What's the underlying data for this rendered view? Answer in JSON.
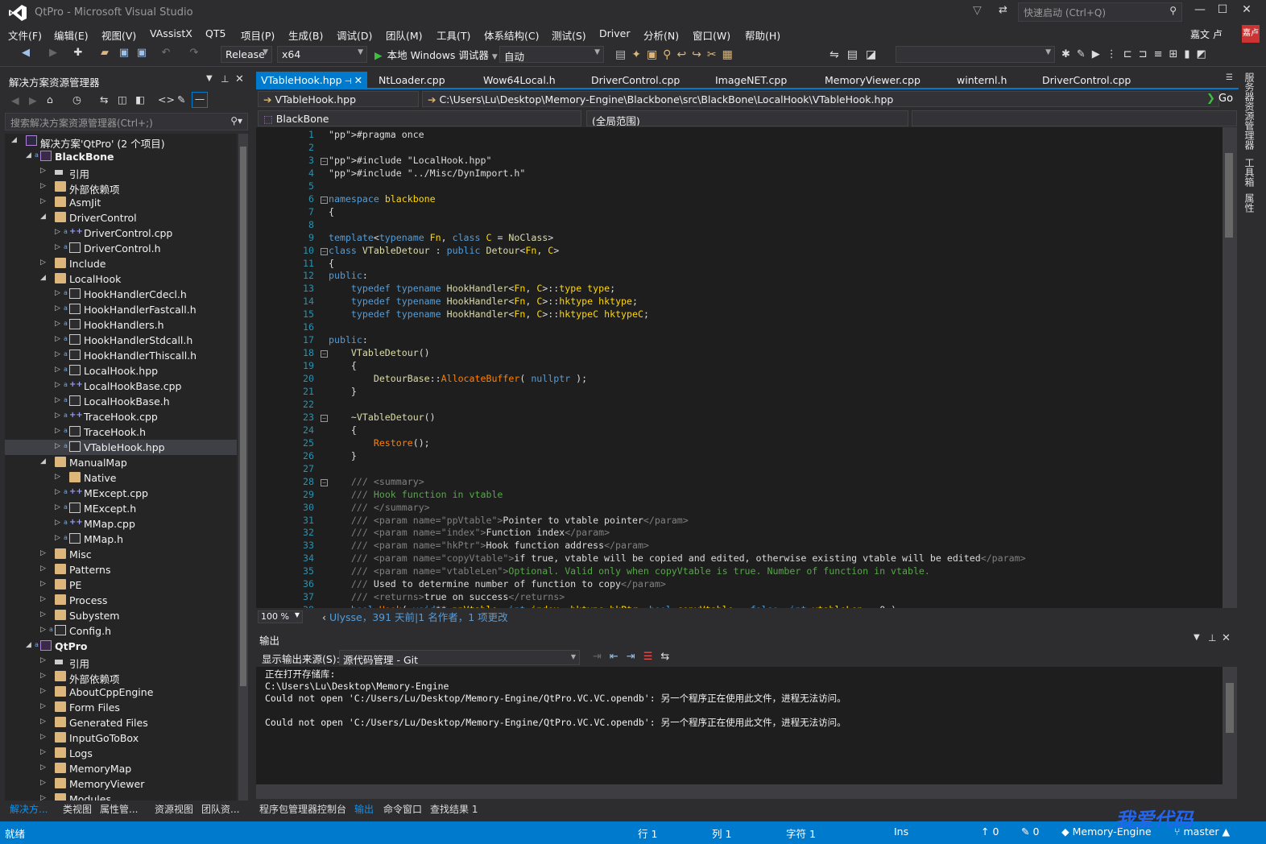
{
  "window": {
    "title": "QtPro - Microsoft Visual Studio",
    "quick_launch": "快速启动 (Ctrl+Q)",
    "user": "嘉文 卢",
    "avatar": "嘉卢"
  },
  "menu": [
    "文件(F)",
    "编辑(E)",
    "视图(V)",
    "VAssistX",
    "QT5",
    "项目(P)",
    "生成(B)",
    "调试(D)",
    "团队(M)",
    "工具(T)",
    "体系结构(C)",
    "测试(S)",
    "Driver",
    "分析(N)",
    "窗口(W)",
    "帮助(H)"
  ],
  "toolbar": {
    "config": "Release",
    "platform": "x64",
    "run_label": "本地 Windows 调试器",
    "run_mode": "自动"
  },
  "solution_explorer": {
    "title": "解决方案资源管理器",
    "search_placeholder": "搜索解决方案资源管理器(Ctrl+;)",
    "items": [
      {
        "label": "解决方案'QtPro' (2 个项目)",
        "type": "solution"
      },
      {
        "label": "BlackBone",
        "type": "project"
      },
      {
        "label": "引用",
        "type": "ref"
      },
      {
        "label": "外部依赖项",
        "type": "folder"
      },
      {
        "label": "AsmJit",
        "type": "folder"
      },
      {
        "label": "DriverControl",
        "type": "folder"
      },
      {
        "label": "DriverControl.cpp",
        "type": "cpp"
      },
      {
        "label": "DriverControl.h",
        "type": "h"
      },
      {
        "label": "Include",
        "type": "folder"
      },
      {
        "label": "LocalHook",
        "type": "folder"
      },
      {
        "label": "HookHandlerCdecl.h",
        "type": "h"
      },
      {
        "label": "HookHandlerFastcall.h",
        "type": "h"
      },
      {
        "label": "HookHandlers.h",
        "type": "h"
      },
      {
        "label": "HookHandlerStdcall.h",
        "type": "h"
      },
      {
        "label": "HookHandlerThiscall.h",
        "type": "h"
      },
      {
        "label": "LocalHook.hpp",
        "type": "h"
      },
      {
        "label": "LocalHookBase.cpp",
        "type": "cpp"
      },
      {
        "label": "LocalHookBase.h",
        "type": "h"
      },
      {
        "label": "TraceHook.cpp",
        "type": "cpp"
      },
      {
        "label": "TraceHook.h",
        "type": "h"
      },
      {
        "label": "VTableHook.hpp",
        "type": "h"
      },
      {
        "label": "ManualMap",
        "type": "folder"
      },
      {
        "label": "Native",
        "type": "folder"
      },
      {
        "label": "MExcept.cpp",
        "type": "cpp"
      },
      {
        "label": "MExcept.h",
        "type": "h"
      },
      {
        "label": "MMap.cpp",
        "type": "cpp"
      },
      {
        "label": "MMap.h",
        "type": "h"
      },
      {
        "label": "Misc",
        "type": "folder"
      },
      {
        "label": "Patterns",
        "type": "folder"
      },
      {
        "label": "PE",
        "type": "folder"
      },
      {
        "label": "Process",
        "type": "folder"
      },
      {
        "label": "Subystem",
        "type": "folder"
      },
      {
        "label": "Config.h",
        "type": "h"
      },
      {
        "label": "QtPro",
        "type": "project"
      },
      {
        "label": "引用",
        "type": "ref"
      },
      {
        "label": "外部依赖项",
        "type": "folder"
      },
      {
        "label": "AboutCppEngine",
        "type": "folder"
      },
      {
        "label": "Form Files",
        "type": "folder"
      },
      {
        "label": "Generated Files",
        "type": "folder"
      },
      {
        "label": "InputGoToBox",
        "type": "folder"
      },
      {
        "label": "Logs",
        "type": "folder"
      },
      {
        "label": "MemoryMap",
        "type": "folder"
      },
      {
        "label": "MemoryViewer",
        "type": "folder"
      },
      {
        "label": "Modules",
        "type": "folder"
      }
    ],
    "bottom_tabs": [
      "解决方...",
      "类视图",
      "属性管...",
      "资源视图",
      "团队资..."
    ]
  },
  "editor": {
    "tabs": [
      "VTableHook.hpp",
      "NtLoader.cpp",
      "Wow64Local.h",
      "DriverControl.cpp",
      "ImageNET.cpp",
      "MemoryViewer.cpp",
      "winternl.h",
      "DriverControl.cpp"
    ],
    "file_combo": "VTableHook.hpp",
    "path": "C:\\Users\\Lu\\Desktop\\Memory-Engine\\Blackbone\\src\\BlackBone\\LocalHook\\VTableHook.hpp",
    "go": "Go",
    "project_combo": "BlackBone",
    "scope_combo": "(全局范围)",
    "zoom": "100 %",
    "git_info": "Ulysse，391 天前|1 名作者，1 项更改"
  },
  "code": [
    "#pragma once",
    "",
    "#include \"LocalHook.hpp\"",
    "#include \"../Misc/DynImport.h\"",
    "",
    "namespace blackbone",
    "{",
    "",
    "template<typename Fn, class C = NoClass>",
    "class VTableDetour : public Detour<Fn, C>",
    "{",
    "public:",
    "    typedef typename HookHandler<Fn, C>::type type;",
    "    typedef typename HookHandler<Fn, C>::hktype hktype;",
    "    typedef typename HookHandler<Fn, C>::hktypeC hktypeC;",
    "",
    "public:",
    "    VTableDetour()",
    "    {",
    "        DetourBase::AllocateBuffer( nullptr );",
    "    }",
    "",
    "    ~VTableDetour()",
    "    {",
    "        Restore();",
    "    }",
    "",
    "    /// <summary>",
    "    /// Hook function in vtable",
    "    /// </summary>",
    "    /// <param name=\"ppVtable\">Pointer to vtable pointer</param>",
    "    /// <param name=\"index\">Function index</param>",
    "    /// <param name=\"hkPtr\">Hook function address</param>",
    "    /// <param name=\"copyVtable\">if true, vtable will be copied and edited, otherwise existing vtable will be edited</param>",
    "    /// <param name=\"vtableLen\">Optional. Valid only when copyVtable is true. Number of function in vtable.",
    "    /// Used to determine number of function to copy</param>",
    "    /// <returns>true on success</returns>",
    "    bool Hook( void** ppVtable, int index, hktype hkPtr, bool copyVtable = false, int vtableLen = 0 )"
  ],
  "output": {
    "title": "输出",
    "source_label": "显示输出来源(S):",
    "source": "源代码管理 - Git",
    "text": "正在打开存储库:\nC:\\Users\\Lu\\Desktop\\Memory-Engine\nCould not open 'C:/Users/Lu/Desktop/Memory-Engine/QtPro.VC.VC.opendb': 另一个程序正在使用此文件，进程无法访问。\n\nCould not open 'C:/Users/Lu/Desktop/Memory-Engine/QtPro.VC.VC.opendb': 另一个程序正在使用此文件，进程无法访问。",
    "bottom_tabs": [
      "程序包管理器控制台",
      "输出",
      "命令窗口",
      "查找结果 1"
    ]
  },
  "right_strip": [
    "服务器资源管理器",
    "工具箱",
    "属性"
  ],
  "status": {
    "ready": "就绪",
    "line": "行 1",
    "col": "列 1",
    "char": "字符 1",
    "ins": "Ins",
    "up": "0",
    "pen": "0",
    "repo": "Memory-Engine",
    "branch": "master"
  },
  "watermark": "我爱代码"
}
